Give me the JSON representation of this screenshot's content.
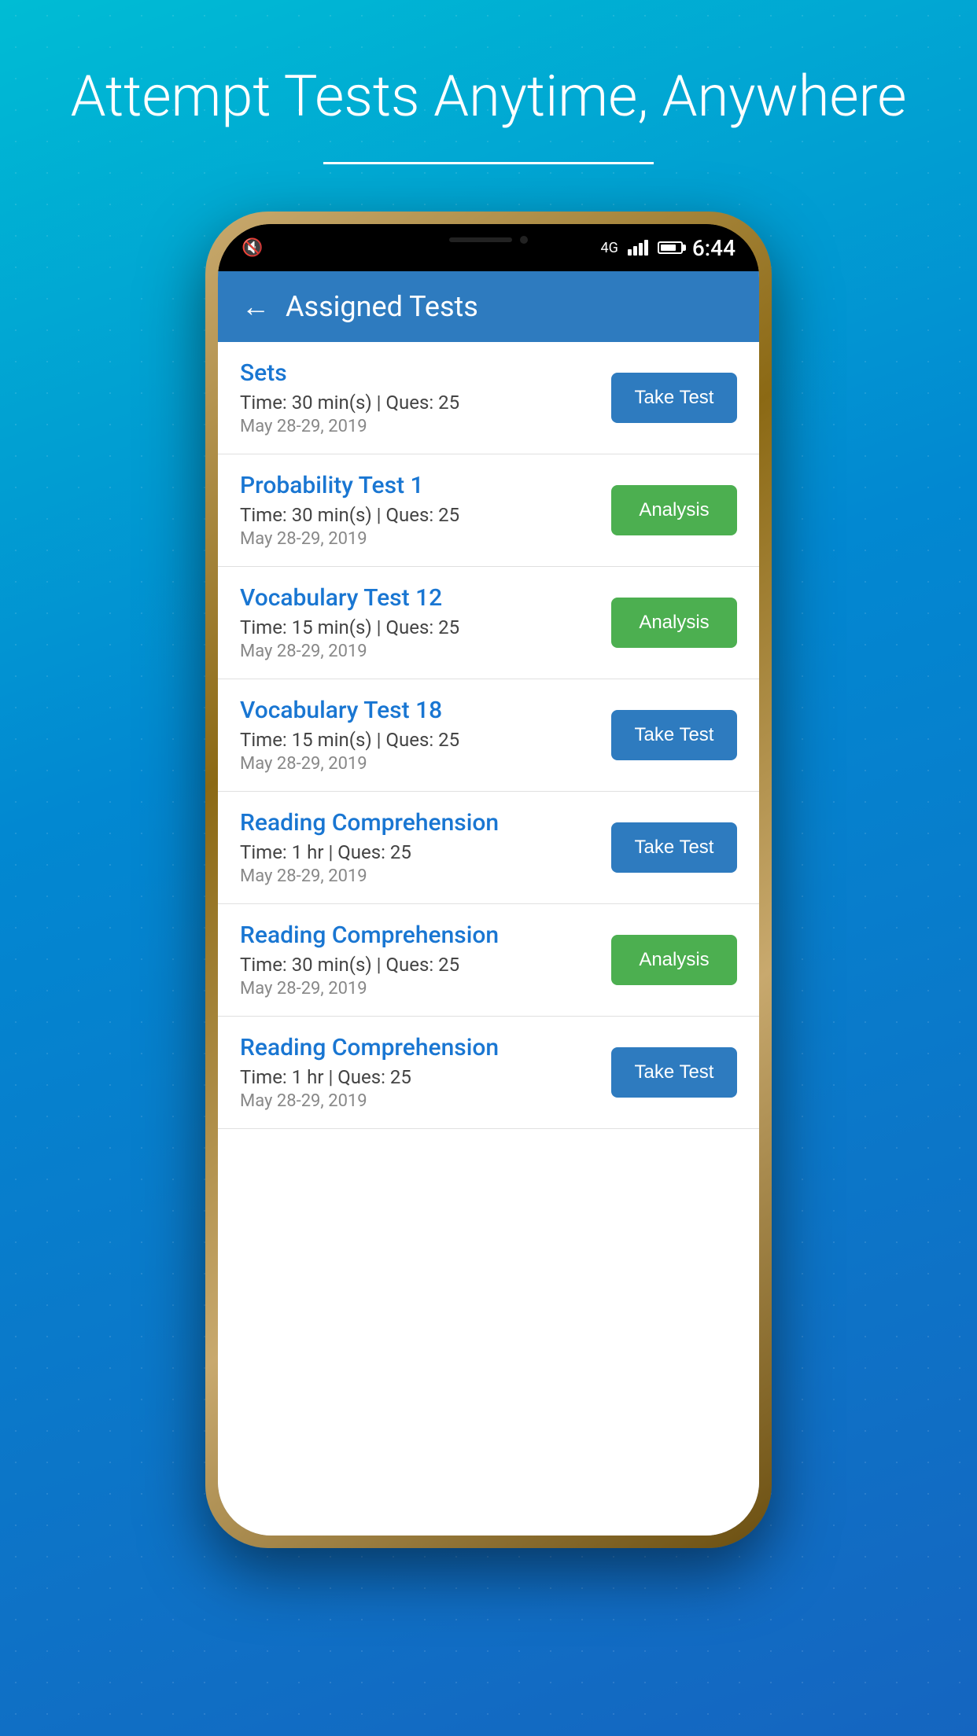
{
  "hero": {
    "title": "Attempt Tests Anytime, Anywhere"
  },
  "status_bar": {
    "time": "6:44",
    "network": "4G",
    "battery_level": "80"
  },
  "header": {
    "title": "Assigned Tests",
    "back_label": "←"
  },
  "tests": [
    {
      "id": 1,
      "name": "Sets",
      "time": "Time: 30 min(s) | Ques: 25",
      "date": "May 28-29, 2019",
      "button_label": "Take Test",
      "button_type": "take"
    },
    {
      "id": 2,
      "name": "Probability Test 1",
      "time": "Time: 30 min(s) | Ques: 25",
      "date": "May 28-29, 2019",
      "button_label": "Analysis",
      "button_type": "analysis"
    },
    {
      "id": 3,
      "name": "Vocabulary Test 12",
      "time": "Time: 15 min(s) | Ques: 25",
      "date": "May 28-29, 2019",
      "button_label": "Analysis",
      "button_type": "analysis"
    },
    {
      "id": 4,
      "name": "Vocabulary Test 18",
      "time": "Time: 15 min(s) | Ques: 25",
      "date": "May 28-29, 2019",
      "button_label": "Take Test",
      "button_type": "take"
    },
    {
      "id": 5,
      "name": "Reading Comprehension",
      "time": "Time: 1 hr | Ques: 25",
      "date": "May 28-29, 2019",
      "button_label": "Take Test",
      "button_type": "take"
    },
    {
      "id": 6,
      "name": "Reading Comprehension",
      "time": "Time: 30 min(s) | Ques: 25",
      "date": "May 28-29, 2019",
      "button_label": "Analysis",
      "button_type": "analysis"
    },
    {
      "id": 7,
      "name": "Reading Comprehension",
      "time": "Time: 1 hr | Ques: 25",
      "date": "May 28-29, 2019",
      "button_label": "Take Test",
      "button_type": "take"
    }
  ]
}
